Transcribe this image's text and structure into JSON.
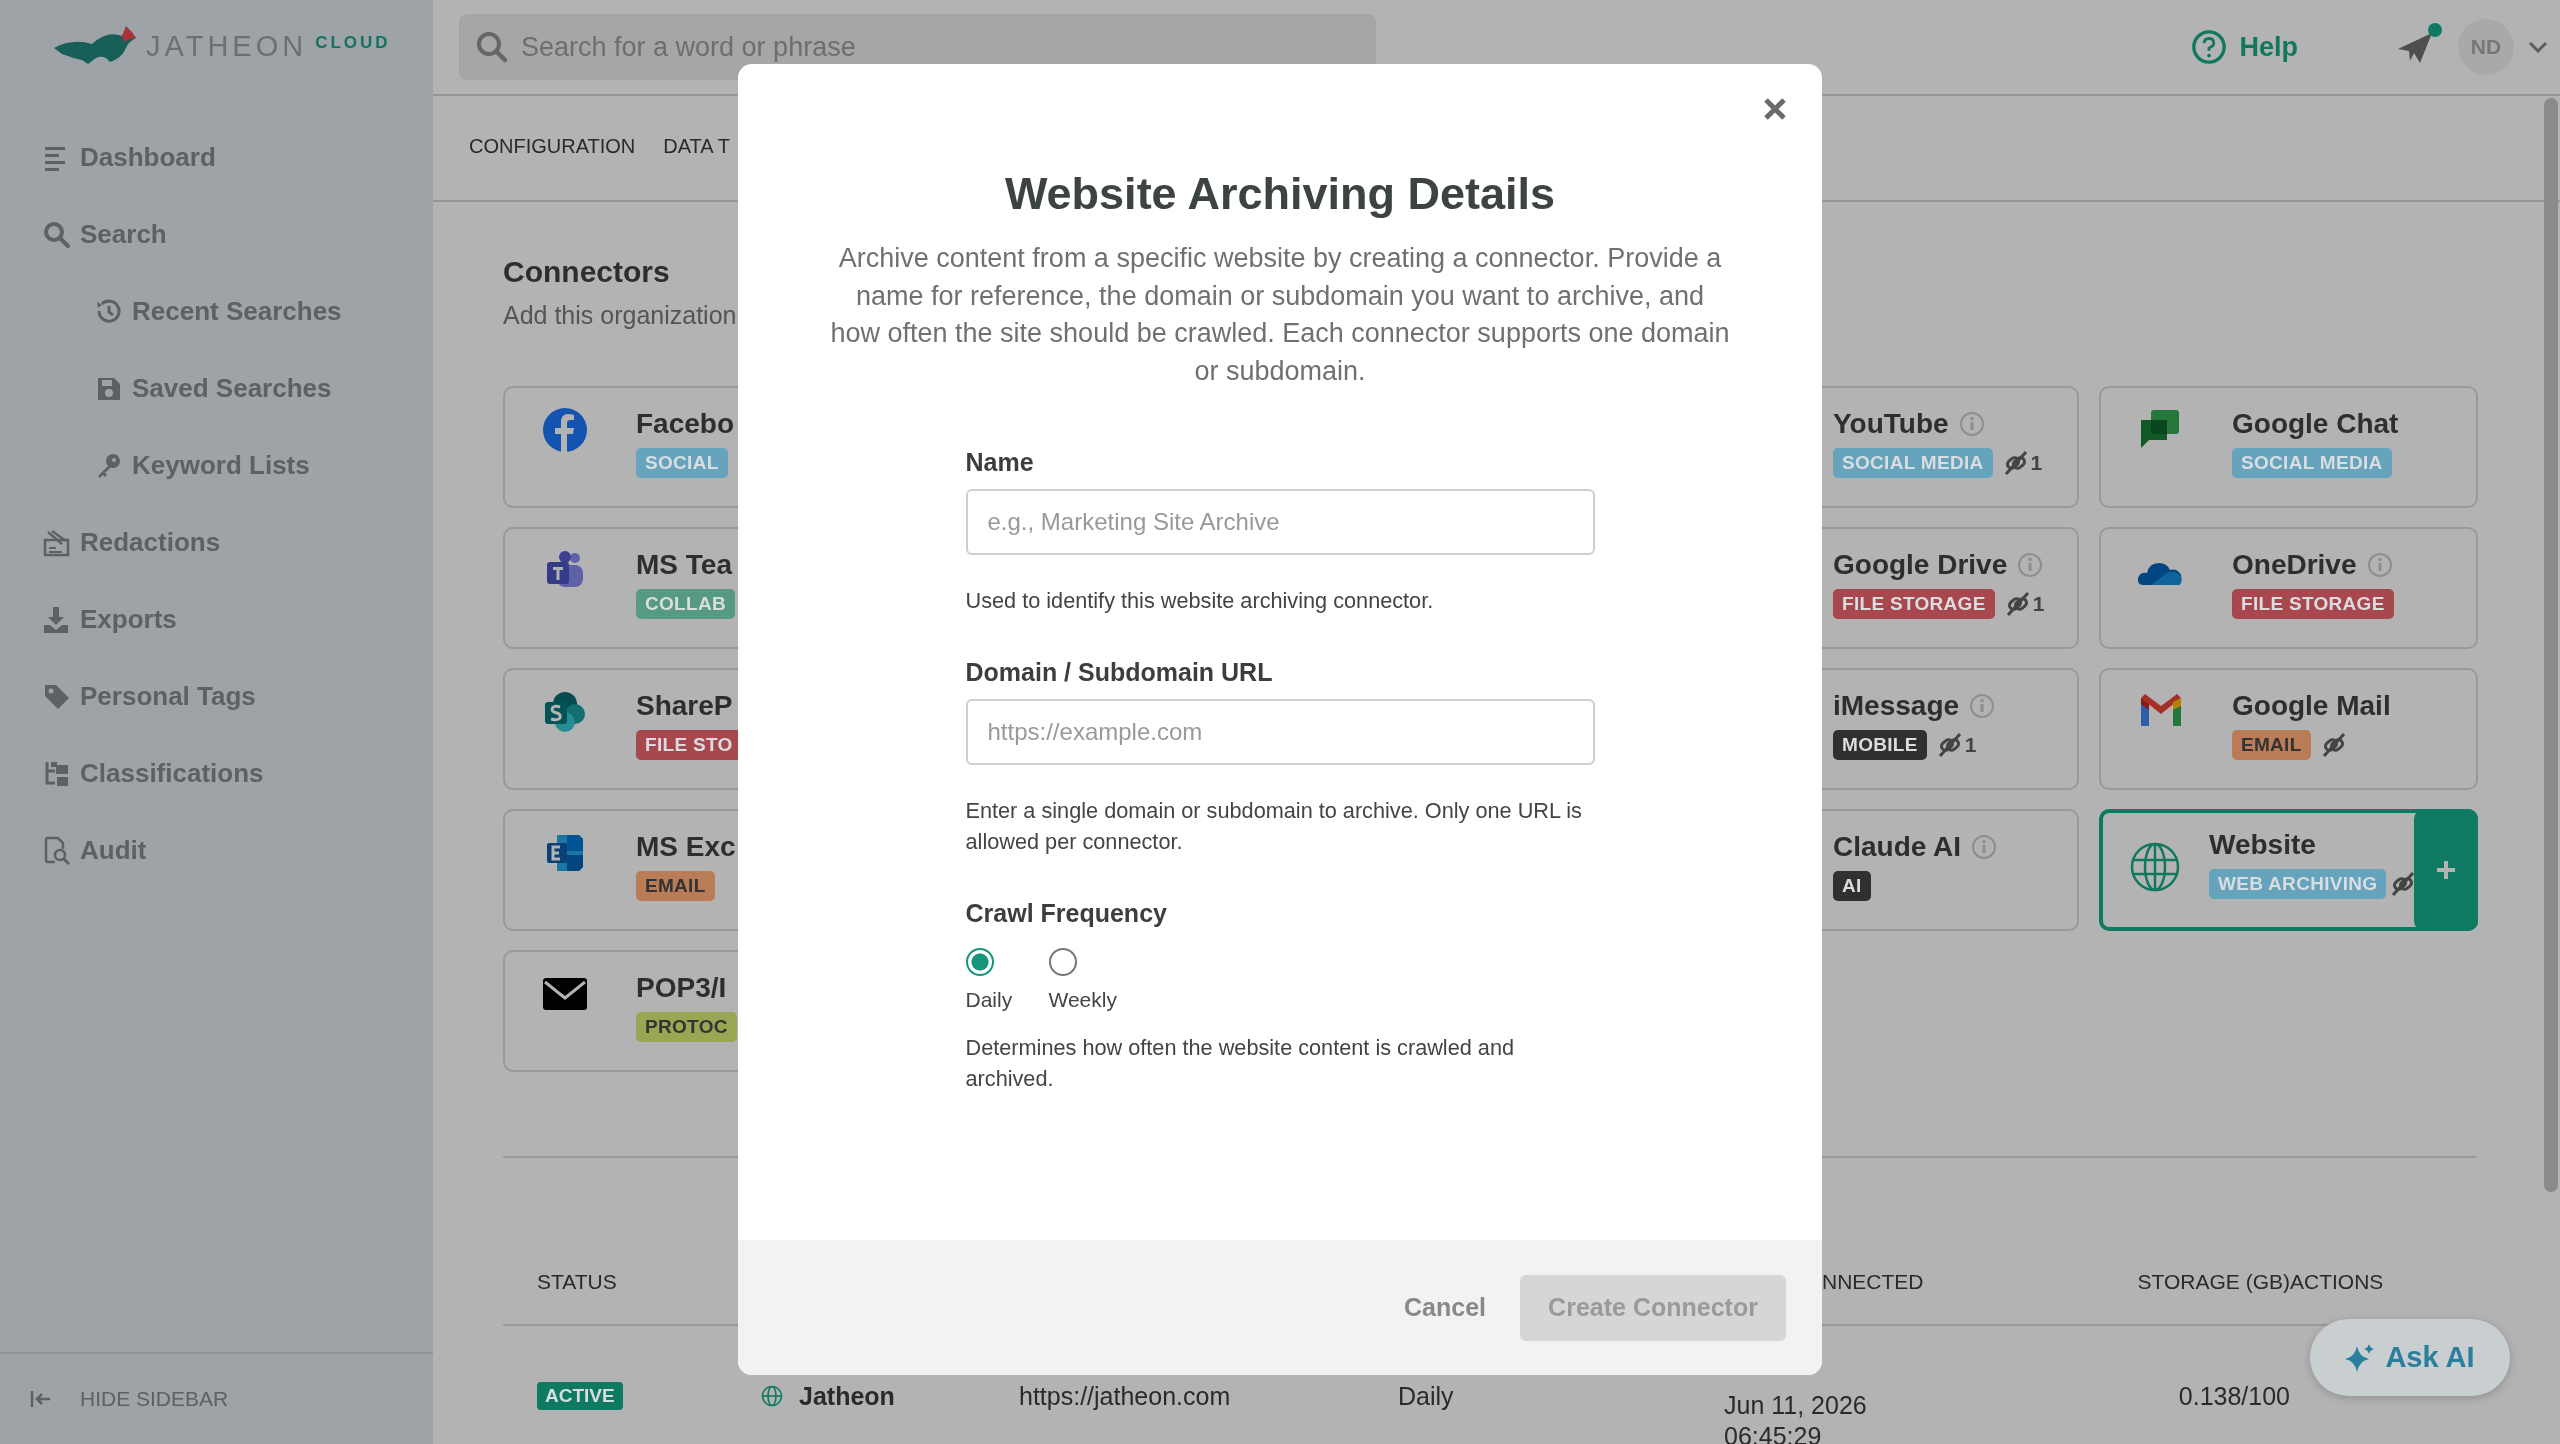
{
  "logo": {
    "wordmark": "JATHEON",
    "suffix": "CLOUD"
  },
  "search": {
    "placeholder": "Search for a word or phrase"
  },
  "header": {
    "help": "Help",
    "has_notification": true,
    "avatar": "ND"
  },
  "sidebar": {
    "items": [
      {
        "label": "Dashboard"
      },
      {
        "label": "Search",
        "children": [
          {
            "label": "Recent Searches"
          },
          {
            "label": "Saved Searches"
          },
          {
            "label": "Keyword Lists"
          }
        ]
      },
      {
        "label": "Redactions"
      },
      {
        "label": "Exports"
      },
      {
        "label": "Personal Tags"
      },
      {
        "label": "Classifications"
      },
      {
        "label": "Audit"
      }
    ],
    "footer": "HIDE SIDEBAR"
  },
  "tabs": [
    {
      "label": "CONFIGURATION",
      "selected": false
    },
    {
      "label": "DATA T",
      "selected": false
    }
  ],
  "connectors": {
    "title": "Connectors",
    "subtitle": "Add this organization",
    "rows": [
      {
        "cards": [
          {
            "name": "Facebo",
            "info": false,
            "badge": {
              "label": "SOCIAL",
              "color": "#66a3bd"
            },
            "linked": false,
            "selected": false
          },
          {
            "name": "YouTube",
            "info": true,
            "badge": {
              "label": "SOCIAL MEDIA",
              "color": "#66a3bd"
            },
            "linked": true,
            "link_count": "1",
            "selected": false
          },
          {
            "name": "Google Chat",
            "info": false,
            "badge": {
              "label": "SOCIAL MEDIA",
              "color": "#66a3bd"
            },
            "linked": false,
            "selected": false
          }
        ]
      },
      {
        "cards": [
          {
            "name": "MS Tea",
            "info": false,
            "badge": {
              "label": "COLLAB",
              "color": "#569a82"
            },
            "linked": false,
            "selected": false
          },
          {
            "name": "Google Drive",
            "info": true,
            "badge": {
              "label": "FILE STORAGE",
              "color": "#a9474f"
            },
            "linked": true,
            "link_count": "1",
            "selected": false
          },
          {
            "name": "OneDrive",
            "info": true,
            "badge": {
              "label": "FILE STORAGE",
              "color": "#a9474f"
            },
            "linked": false,
            "selected": false
          }
        ]
      },
      {
        "cards": [
          {
            "name": "ShareP",
            "info": false,
            "badge": {
              "label": "FILE STO",
              "color": "#a9474f"
            },
            "linked": false,
            "selected": false
          },
          {
            "name": "iMessage",
            "info": true,
            "badge": {
              "label": "MOBILE",
              "color": "#303030"
            },
            "linked": true,
            "link_count": "1",
            "selected": false
          },
          {
            "name": "Google Mail",
            "info": false,
            "badge": {
              "label": "EMAIL",
              "color": "#b97c56"
            },
            "linked": true,
            "selected": false
          }
        ]
      },
      {
        "cards": [
          {
            "name": "MS Exc",
            "info": false,
            "badge": {
              "label": "EMAIL",
              "color": "#b97c56"
            },
            "linked": false,
            "selected": false
          },
          {
            "name": "Claude AI",
            "info": true,
            "badge": {
              "label": "AI",
              "color": "#303030"
            },
            "linked": false,
            "selected": false
          },
          {
            "name": "Website",
            "info": false,
            "badge": {
              "label": "WEB ARCHIVING",
              "color": "#66a3bd"
            },
            "linked": true,
            "selected": true
          }
        ]
      },
      {
        "cards": [
          {
            "name": "POP3/I",
            "info": false,
            "badge": {
              "label": "PROTOC",
              "color": "#9aa654"
            },
            "linked": false,
            "selected": false
          }
        ]
      }
    ]
  },
  "table": {
    "columns": [
      "STATUS",
      "NNECTED",
      "STORAGE (GB)",
      "ACTIONS"
    ],
    "rows": [
      {
        "status": "ACTIVE",
        "name": "Jatheon",
        "url": "https://jatheon.com",
        "frequency": "Daily",
        "connected": [
          "Jun 11, 2026",
          "06:45:29"
        ],
        "storage": "0.138/100"
      }
    ]
  },
  "ask_ai": "Ask AI",
  "modal": {
    "title": "Website Archiving Details",
    "description": "Archive content from a specific website by creating a connector. Provide a name for reference, the domain or subdomain you want to archive, and how often the site should be crawled. Each connector supports one domain or subdomain.",
    "fields": [
      {
        "label": "Name",
        "placeholder": "e.g., Marketing Site Archive",
        "hint": "Used to identify this website archiving connector."
      },
      {
        "label": "Domain / Subdomain URL",
        "placeholder": "https://example.com",
        "hint": "Enter a single domain or subdomain to archive. Only one URL is allowed per connector."
      }
    ],
    "frequency": {
      "label": "Crawl Frequency",
      "options": [
        {
          "label": "Daily",
          "selected": true
        },
        {
          "label": "Weekly",
          "selected": false
        }
      ],
      "hint": "Determines how often the website content is crawled and archived."
    },
    "buttons": [
      {
        "label": "Cancel",
        "kind": "text",
        "disabled": false
      },
      {
        "label": "Create Connector",
        "kind": "primary",
        "disabled": true
      }
    ]
  }
}
